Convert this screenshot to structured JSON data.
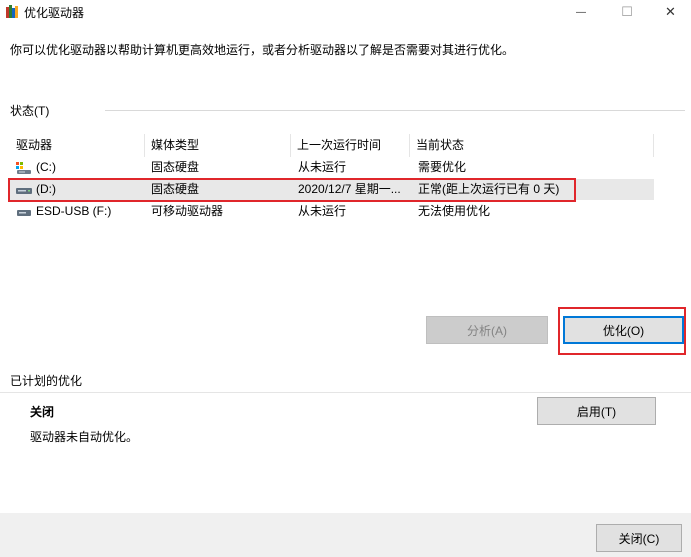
{
  "window": {
    "title": "优化驱动器",
    "minimize_glyph": "—",
    "maximize_glyph": "☐",
    "close_glyph": "✕"
  },
  "intro": "你可以优化驱动器以帮助计算机更高效地运行，或者分析驱动器以了解是否需要对其进行优化。",
  "status": {
    "label": "状态(T)",
    "columns": [
      "驱动器",
      "媒体类型",
      "上一次运行时间",
      "当前状态"
    ],
    "rows": [
      {
        "drive": "(C:)",
        "icon": "system-drive-icon",
        "media": "固态硬盘",
        "last_run": "从未运行",
        "state": "需要优化"
      },
      {
        "drive": "(D:)",
        "icon": "hard-drive-icon",
        "media": "固态硬盘",
        "last_run": "2020/12/7 星期一...",
        "state": "正常(距上次运行已有 0 天)"
      },
      {
        "drive": "ESD-USB (F:)",
        "icon": "usb-drive-icon",
        "media": "可移动驱动器",
        "last_run": "从未运行",
        "state": "无法使用优化"
      }
    ]
  },
  "actions": {
    "analyze_label": "分析(A)",
    "optimize_label": "优化(O)"
  },
  "schedule": {
    "label": "已计划的优化",
    "state": "关闭",
    "description": "驱动器未自动优化。",
    "enable_label": "启用(T)"
  },
  "footer": {
    "close_label": "关闭(C)"
  },
  "colors": {
    "highlight": "#e0262b",
    "accent": "#0078d7"
  }
}
